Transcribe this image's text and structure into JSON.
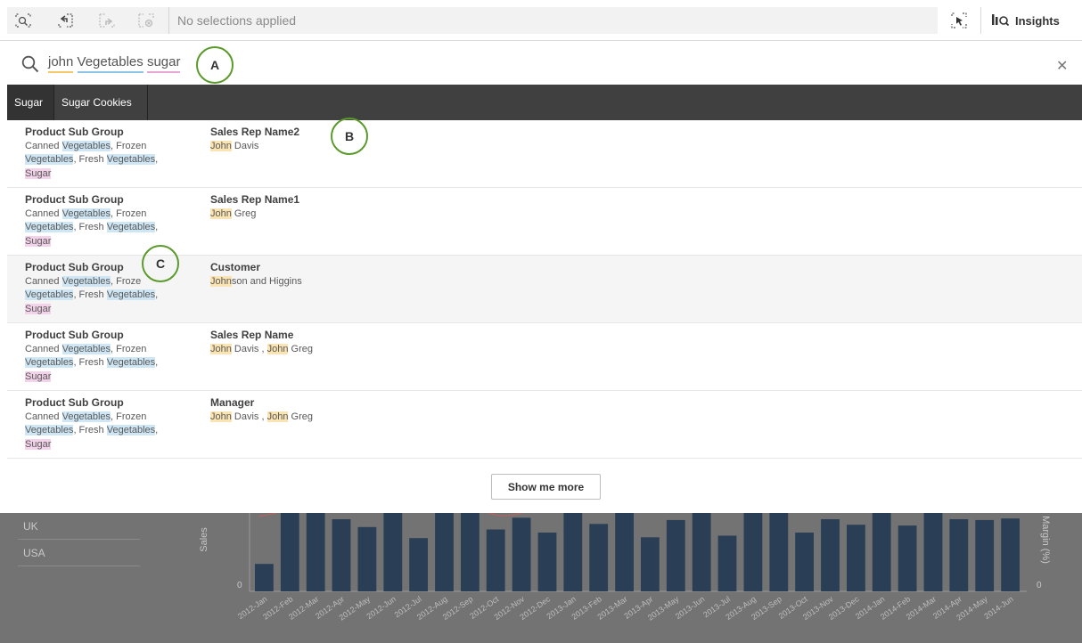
{
  "toolbar": {
    "status": "No selections applied",
    "insights_label": "Insights"
  },
  "search": {
    "terms": [
      "john",
      "Vegetables",
      "sugar"
    ]
  },
  "callouts": {
    "a": "A",
    "b": "B",
    "c": "C"
  },
  "tabs": [
    "Sugar",
    "Sugar Cookies"
  ],
  "results": [
    {
      "field1": "Product Sub Group",
      "field2": "Sales Rep Name2",
      "v1a": "Canned ",
      "v1b": "Vegetables",
      "v1c": ", Frozen ",
      "v1d": "Vegetables",
      "v1e": ", Fresh ",
      "v1f": "Vegetables",
      "v1g": ", ",
      "v1h": "Sugar",
      "v2": [
        [
          "John",
          " Davis"
        ]
      ]
    },
    {
      "field1": "Product Sub Group",
      "field2": "Sales Rep Name1",
      "v1a": "Canned ",
      "v1b": "Vegetables",
      "v1c": ", Frozen ",
      "v1d": "Vegetables",
      "v1e": ", Fresh ",
      "v1f": "Vegetables",
      "v1g": ", ",
      "v1h": "Sugar",
      "v2": [
        [
          "John",
          " Greg"
        ]
      ]
    },
    {
      "field1": "Product Sub Group",
      "field2": "Customer",
      "v1a": "Canned ",
      "v1b": "Vegetables",
      "v1c": ", Froze",
      "v1d": "",
      "v1e": "",
      "v1f": "Vegetables",
      "v1g": ", Fresh ",
      "v1h": "Sugar",
      "v1f2": "Vegetables",
      "v2": [
        [
          "John",
          "son and Higgins"
        ]
      ]
    },
    {
      "field1": "Product Sub Group",
      "field2": "Sales Rep Name",
      "v1a": "Canned ",
      "v1b": "Vegetables",
      "v1c": ", Frozen ",
      "v1d": "Vegetables",
      "v1e": ", Fresh ",
      "v1f": "Vegetables",
      "v1g": ", ",
      "v1h": "Sugar",
      "v2": [
        [
          "John",
          " Davis , "
        ],
        [
          "John",
          " Greg"
        ]
      ]
    },
    {
      "field1": "Product Sub Group",
      "field2": "Manager",
      "v1a": "Canned ",
      "v1b": "Vegetables",
      "v1c": ", Frozen ",
      "v1d": "Vegetables",
      "v1e": ", Fresh ",
      "v1f": "Vegetables",
      "v1g": ", ",
      "v1h": "Sugar",
      "v2": [
        [
          "John",
          " Davis , "
        ],
        [
          "John",
          " Greg"
        ]
      ]
    }
  ],
  "show_more_label": "Show me more",
  "background": {
    "countries": [
      "UK",
      "USA"
    ],
    "y_label": "Sales",
    "y2_label": "Margin (%)",
    "y_zero": "0",
    "y2_zero": "0"
  },
  "chart_data": {
    "type": "bar",
    "ylabel": "Sales",
    "categories": [
      "2012-Jan",
      "2012-Feb",
      "2012-Mar",
      "2012-Apr",
      "2012-May",
      "2012-Jun",
      "2012-Jul",
      "2012-Aug",
      "2012-Sep",
      "2012-Oct",
      "2012-Nov",
      "2012-Dec",
      "2013-Jan",
      "2013-Feb",
      "2013-Mar",
      "2013-Apr",
      "2013-May",
      "2013-Jun",
      "2013-Jul",
      "2013-Aug",
      "2013-Sep",
      "2013-Oct",
      "2013-Nov",
      "2013-Dec",
      "2014-Jan",
      "2014-Feb",
      "2014-Mar",
      "2014-Apr",
      "2014-May",
      "2014-Jun"
    ],
    "values": [
      35,
      100,
      100,
      92,
      82,
      100,
      68,
      100,
      100,
      79,
      94,
      75,
      100,
      86,
      100,
      69,
      91,
      100,
      71,
      100,
      100,
      75,
      92,
      85,
      100,
      84,
      100,
      92,
      91,
      93
    ],
    "bar_color": "#2a3f55"
  }
}
